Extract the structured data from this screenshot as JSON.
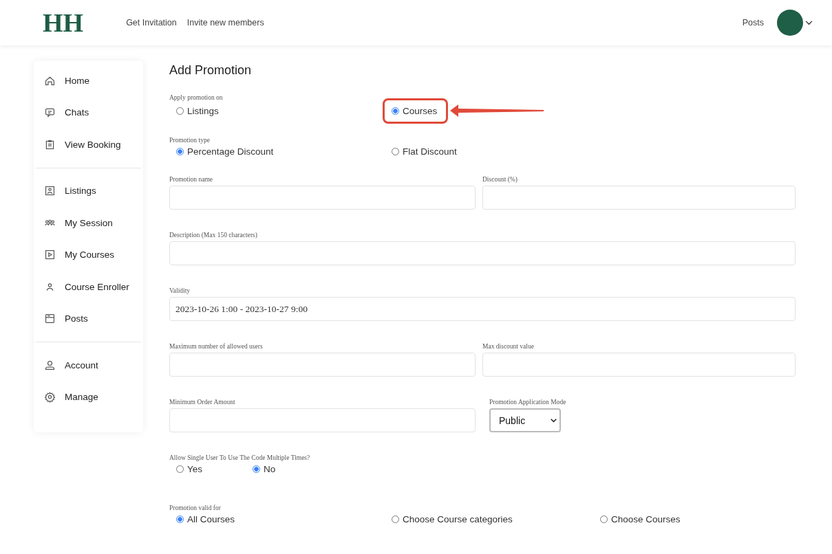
{
  "header": {
    "logo": "HH",
    "nav": [
      "Get Invitation",
      "Invite new members"
    ],
    "right_link": "Posts"
  },
  "sidebar": {
    "sections": [
      {
        "items": [
          {
            "label": "Home"
          },
          {
            "label": "Chats"
          },
          {
            "label": "View Booking"
          }
        ]
      },
      {
        "items": [
          {
            "label": "Listings"
          },
          {
            "label": "My Session"
          },
          {
            "label": "My Courses"
          },
          {
            "label": "Course Enroller"
          },
          {
            "label": "Posts"
          }
        ]
      },
      {
        "items": [
          {
            "label": "Account"
          },
          {
            "label": "Manage"
          }
        ]
      }
    ]
  },
  "form": {
    "title": "Add Promotion",
    "rows": [
      {
        "kind": "radio",
        "label": "Apply promotion on",
        "options": [
          {
            "label": "Listings",
            "selected": false,
            "highlighted": false
          },
          {
            "label": "Courses",
            "selected": true,
            "highlighted": true
          }
        ]
      },
      {
        "kind": "radio",
        "label": "Promotion type",
        "options": [
          {
            "label": "Percentage Discount",
            "selected": true,
            "highlighted": false
          },
          {
            "label": "Flat Discount",
            "selected": false,
            "highlighted": false
          }
        ]
      },
      {
        "kind": "fields",
        "fields": [
          {
            "label": "Promotion name"
          },
          {
            "label": "Discount (%)"
          }
        ]
      },
      {
        "kind": "fields",
        "fields": [
          {
            "label": "Description (Max 150 characters)"
          }
        ]
      },
      {
        "kind": "fields",
        "fields": [
          {
            "label": "Validity",
            "value": "2023-10-26 1:00 - 2023-10-27 9:00"
          }
        ]
      },
      {
        "kind": "fields",
        "fields": [
          {
            "label": "Maximum number of allowed users"
          },
          {
            "label": "Max discount value"
          }
        ]
      },
      {
        "kind": "fields",
        "fields": [
          {
            "label": "Minimum Order Amount"
          },
          {
            "label": "Promotion Application Mode",
            "select": "Public"
          }
        ]
      },
      {
        "kind": "radio",
        "label": "Allow Single User To Use The Code Multiple Times?",
        "narrow": true,
        "options": [
          {
            "label": "Yes",
            "selected": false,
            "highlighted": false
          },
          {
            "label": "No",
            "selected": true,
            "highlighted": false
          }
        ]
      },
      {
        "kind": "radio",
        "label": "Promotion valid for",
        "options": [
          {
            "label": "All Courses",
            "selected": true,
            "highlighted": false
          },
          {
            "label": "Choose Course categories",
            "selected": false,
            "highlighted": false
          },
          {
            "label": "Choose Courses",
            "selected": false,
            "highlighted": false
          }
        ]
      }
    ]
  }
}
